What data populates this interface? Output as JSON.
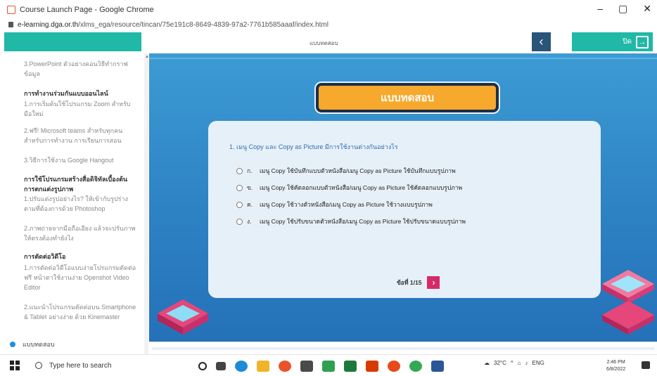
{
  "browser": {
    "title": "Course Launch Page - Google Chrome",
    "url_domain": "e-learning.dga.or.th",
    "url_path": "/xlms_ega/resource/tincan/75e191c8-8649-4839-97a2-7761b585aaaf/index.html",
    "window_controls": [
      "–",
      "▢",
      "✕"
    ]
  },
  "course_header": {
    "title": "แบบทดสอบ",
    "back_label": "‹",
    "exit_label": "ปิด"
  },
  "sidebar": {
    "items": [
      {
        "text": "3.PowerPoint ตัวอย่างคอนวิธีทำกราฟข้อมูล",
        "heading": false
      },
      {
        "text": "การทำงานร่วมกันแบบออนไลน์",
        "heading": true
      },
      {
        "text": "1.การเริ่มต้นใช้โปรแกรม Zoom สำหรับมือใหม่",
        "heading": false
      },
      {
        "text": "2.ฟรี! Microsoft teams สำหรับทุกคน สำหรับการทำงาน การเรียนการสอน",
        "heading": false
      },
      {
        "text": "3.วิธีการใช้งาน Google Hangout",
        "heading": false
      },
      {
        "text": "การใช้โปรแกรมสร้างสื่อดิจิทัลเบื้องต้นการตกแต่งรูปภาพ",
        "heading": true
      },
      {
        "text": "1.ปรับแต่งรูปอย่างไร? ให้เข้ากับรูปร่างตามที่ต้องการด้วย Photoshop",
        "heading": false
      },
      {
        "text": "2.ภาพถ่ายจากมือถือเอียง แล้วจะปรับภาพให้ตรงต้องทำยังไง",
        "heading": false
      },
      {
        "text": "การตัดต่อวิดีโอ",
        "heading": true
      },
      {
        "text": "1.การตัดต่อวิดีโอแบบง่ายโปรแกรมตัดต่อฟรี หน้าตาใช้งานง่าย Openshot Video Editor",
        "heading": false
      },
      {
        "text": "2.แนะนำโปรแกรมตัดต่อบน Smartphone & Tablet อย่างง่าย ด้วย Kinemaster",
        "heading": false
      }
    ],
    "active_item": "แบบทดสอบ"
  },
  "quiz": {
    "banner": "แบบทดสอบ",
    "question": "1. เมนู Copy และ Copy as Picture มีการใช้งานต่างกันอย่างไร",
    "choices": [
      {
        "letter": "ก.",
        "text": "เมนู Copy ใช้บันทึกแบบตัวหนังสือ/เมนู Copy as Picture ใช้บันทึกแบบรูปภาพ"
      },
      {
        "letter": "ข.",
        "text": "เมนู Copy ใช้คัดลอกแบบตัวหนังสือ/เมนู Copy as Picture ใช้คัดลอกแบบรูปภาพ"
      },
      {
        "letter": "ค.",
        "text": "เมนู Copy ใช้วางตัวหนังสือ/เมนู Copy as Picture ใช้วางแบบรูปภาพ"
      },
      {
        "letter": "ง.",
        "text": "เมนู Copy ใช้ปรับขนาดตัวหนังสือ/เมนู Copy as Picture ใช้ปรับขนาดแบบรูปภาพ"
      }
    ],
    "pager": "ข้อที่ 1/15",
    "next_label": "›"
  },
  "taskbar": {
    "search_placeholder": "Type here to search",
    "temperature": "32°C",
    "language": "ENG",
    "time": "2:46 PM",
    "date": "6/8/2022"
  },
  "colors": {
    "teal": "#20b8a6",
    "navy": "#2a5478",
    "banner_orange": "#f6a92d",
    "stage_blue": "#2d82c4",
    "next_pink": "#d62a66"
  }
}
